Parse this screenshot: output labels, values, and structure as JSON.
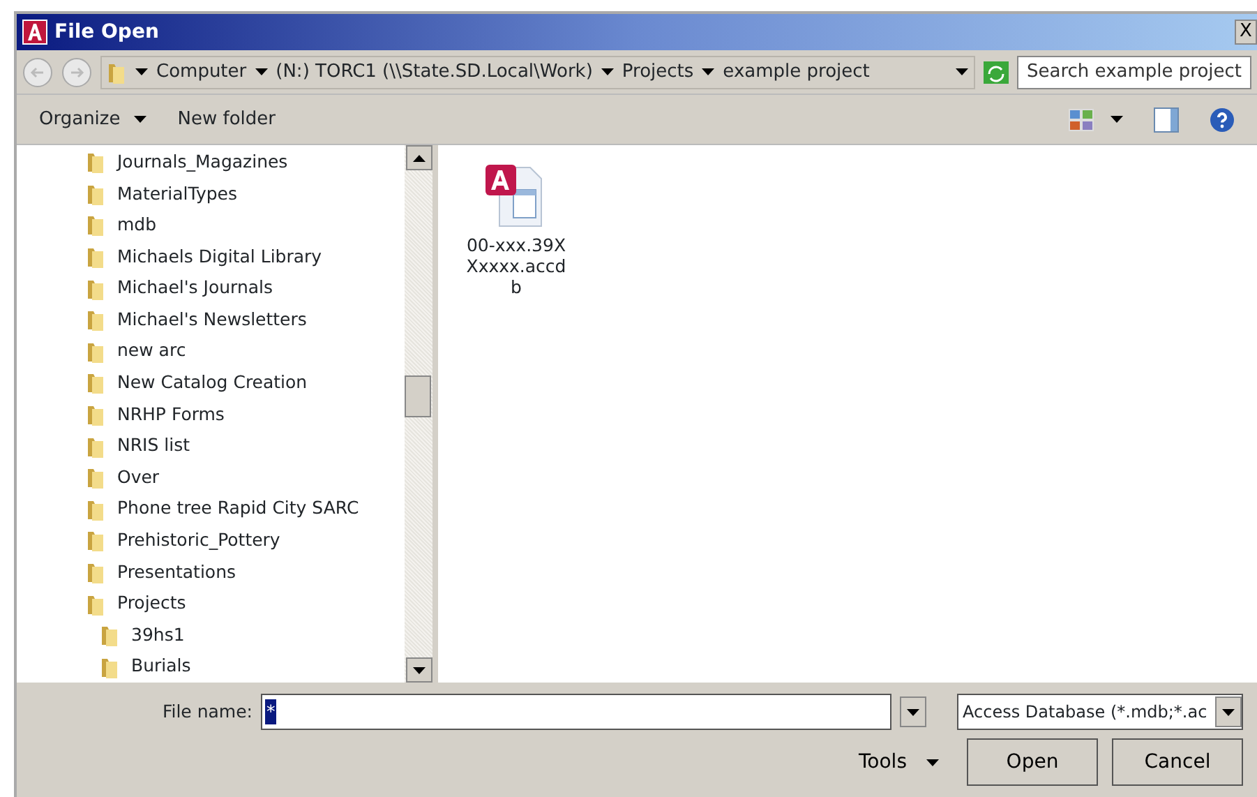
{
  "window": {
    "title": "File Open",
    "close": "X"
  },
  "address_bar": {
    "path": [
      {
        "label": "Computer"
      },
      {
        "label": "(N:) TORC1 (\\\\State.SD.Local\\Work)"
      },
      {
        "label": "Projects"
      },
      {
        "label": "example project"
      }
    ]
  },
  "search": {
    "placeholder": "Search example project"
  },
  "toolbar": {
    "organize": "Organize",
    "new_folder": "New folder"
  },
  "tree": [
    {
      "label": "Journals_Magazines"
    },
    {
      "label": "MaterialTypes"
    },
    {
      "label": "mdb"
    },
    {
      "label": "Michaels Digital Library"
    },
    {
      "label": "Michael's Journals"
    },
    {
      "label": "Michael's Newsletters"
    },
    {
      "label": "new arc"
    },
    {
      "label": "New Catalog Creation"
    },
    {
      "label": "NRHP Forms"
    },
    {
      "label": "NRIS list"
    },
    {
      "label": "Over"
    },
    {
      "label": "Phone tree Rapid City SARC"
    },
    {
      "label": "Prehistoric_Pottery"
    },
    {
      "label": "Presentations"
    },
    {
      "label": "Projects",
      "children": [
        {
          "label": "39hs1"
        },
        {
          "label": "Burials"
        }
      ]
    }
  ],
  "files": [
    {
      "lines": [
        "00-xxx.39X",
        "Xxxxx.accd",
        "b"
      ]
    }
  ],
  "file_name": {
    "label": "File name:",
    "value": "*",
    "value_selected": true
  },
  "file_type": {
    "value": "Access Database (*.mdb;*.ac"
  },
  "buttons": {
    "tools": "Tools",
    "open": "Open",
    "cancel": "Cancel"
  }
}
